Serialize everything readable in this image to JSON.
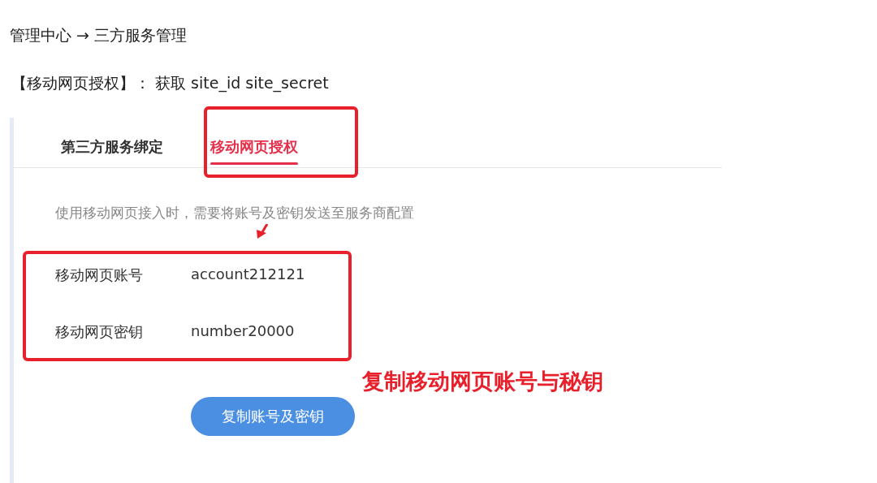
{
  "breadcrumb": "管理中心 → 三方服务管理",
  "heading": "【移动网页授权】： 获取 site_id site_secret",
  "tabs": [
    {
      "label": "第三方服务绑定",
      "selected": false
    },
    {
      "label": "移动网页授权",
      "selected": true
    }
  ],
  "description": "使用移动网页接入时，需要将账号及密钥发送至服务商配置",
  "fields": [
    {
      "label": "移动网页账号",
      "value": "account212121"
    },
    {
      "label": "移动网页密钥",
      "value": "number20000"
    }
  ],
  "button": "复制账号及密钥",
  "callout": "复制移动网页账号与秘钥"
}
